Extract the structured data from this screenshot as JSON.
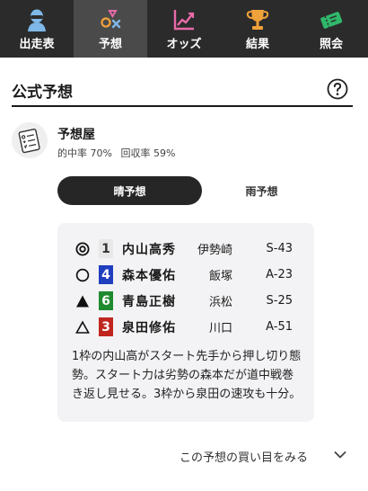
{
  "nav": {
    "items": [
      {
        "label": "出走表",
        "icon": "racer-icon",
        "active": false
      },
      {
        "label": "予想",
        "icon": "prediction-icon",
        "active": true
      },
      {
        "label": "オッズ",
        "icon": "odds-chart-icon",
        "active": false
      },
      {
        "label": "結果",
        "icon": "trophy-icon",
        "active": false
      },
      {
        "label": "照会",
        "icon": "ticket-icon",
        "active": false
      }
    ]
  },
  "section": {
    "title": "公式予想",
    "help_icon": "help-icon"
  },
  "predictor": {
    "name": "予想屋",
    "hit_rate": "的中率 70%",
    "recovery_rate": "回収率 59%"
  },
  "tabs": {
    "sunny": "晴予想",
    "rainy": "雨予想",
    "active": "sunny"
  },
  "picks": [
    {
      "mark": "◎",
      "lane": "1",
      "lane_color": "#e8e8e8",
      "lane_text_color": "#333333",
      "name": "内山高秀",
      "branch": "伊勢崎",
      "rank": "S-43"
    },
    {
      "mark": "○",
      "lane": "4",
      "lane_color": "#1f3fbf",
      "lane_text_color": "#ffffff",
      "name": "森本優佑",
      "branch": "飯塚",
      "rank": "A-23"
    },
    {
      "mark": "▲",
      "lane": "6",
      "lane_color": "#1f8a2e",
      "lane_text_color": "#ffffff",
      "name": "青島正樹",
      "branch": "浜松",
      "rank": "S-25"
    },
    {
      "mark": "△",
      "lane": "3",
      "lane_color": "#c0261f",
      "lane_text_color": "#ffffff",
      "name": "泉田修佑",
      "branch": "川口",
      "rank": "A-51"
    }
  ],
  "comment": "1枠の内山高がスタート先手から押し切り態勢。スタート力は劣勢の森本だが道中戦巻き返し見せる。3枠から泉田の速攻も十分。",
  "more_link": "この予想の買い目をみる"
}
